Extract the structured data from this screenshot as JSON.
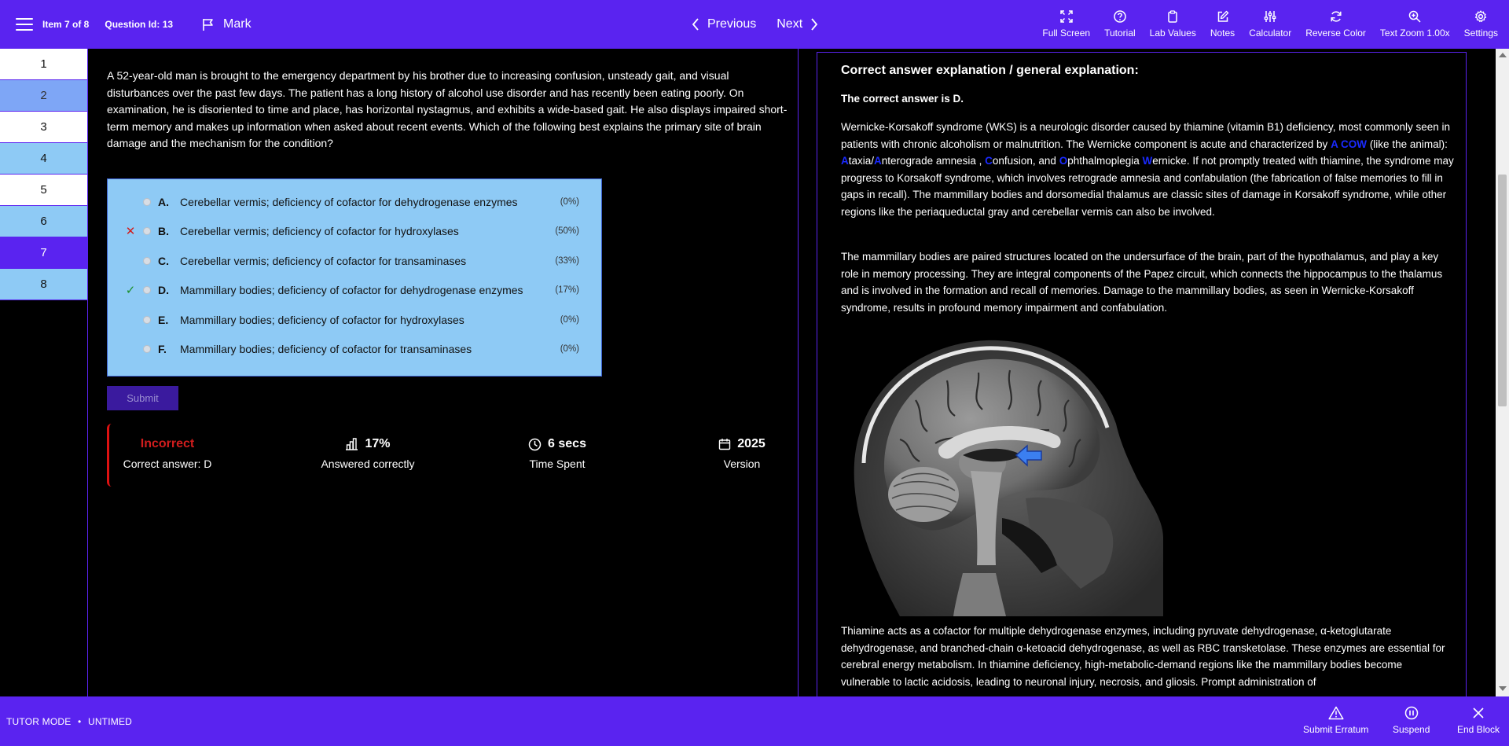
{
  "topbar": {
    "item_label": "Item 7 of 8",
    "question_id": "Question Id: 13",
    "mark_label": "Mark",
    "previous_label": "Previous",
    "next_label": "Next",
    "tools": [
      {
        "label": "Full Screen",
        "icon": "fullscreen-icon"
      },
      {
        "label": "Tutorial",
        "icon": "help-icon"
      },
      {
        "label": "Lab Values",
        "icon": "clipboard-icon"
      },
      {
        "label": "Notes",
        "icon": "edit-icon"
      },
      {
        "label": "Calculator",
        "icon": "sliders-icon"
      },
      {
        "label": "Reverse Color",
        "icon": "refresh-icon"
      },
      {
        "label": "Text Zoom 1.00x",
        "icon": "zoom-icon"
      },
      {
        "label": "Settings",
        "icon": "gear-icon"
      }
    ]
  },
  "sidebar": {
    "items": [
      {
        "label": "1",
        "state": "unanswered"
      },
      {
        "label": "2",
        "state": "visited"
      },
      {
        "label": "3",
        "state": "unanswered"
      },
      {
        "label": "4",
        "state": "answered"
      },
      {
        "label": "5",
        "state": "unanswered"
      },
      {
        "label": "6",
        "state": "answered"
      },
      {
        "label": "7",
        "state": "current"
      },
      {
        "label": "8",
        "state": "answered"
      }
    ]
  },
  "question": {
    "stem": "A 52-year-old man is brought to the emergency department by his brother due to increasing confusion, unsteady gait, and visual disturbances over the past few days. The patient has a long history of alcohol use disorder and has recently been eating poorly. On examination, he is disoriented to time and place, has horizontal nystagmus, and exhibits a wide-based gait. He also displays impaired short-term memory and makes up information when asked about recent events. Which of the following best explains the primary site of brain damage and the mechanism for the condition?",
    "choices": [
      {
        "letter": "A.",
        "text": "Cerebellar vermis; deficiency of cofactor for dehydrogenase enzymes",
        "pct": "(0%)",
        "status": ""
      },
      {
        "letter": "B.",
        "text": "Cerebellar vermis; deficiency of cofactor for hydroxylases",
        "pct": "(50%)",
        "status": "wrong"
      },
      {
        "letter": "C.",
        "text": "Cerebellar vermis; deficiency of cofactor for transaminases",
        "pct": "(33%)",
        "status": ""
      },
      {
        "letter": "D.",
        "text": "Mammillary bodies; deficiency of cofactor for dehydrogenase enzymes",
        "pct": "(17%)",
        "status": "right"
      },
      {
        "letter": "E.",
        "text": "Mammillary bodies; deficiency of cofactor for hydroxylases",
        "pct": "(0%)",
        "status": ""
      },
      {
        "letter": "F.",
        "text": "Mammillary bodies; deficiency of cofactor for transaminases",
        "pct": "(0%)",
        "status": ""
      }
    ],
    "submit_label": "Submit"
  },
  "result": {
    "status": "Incorrect",
    "correct_answer": "Correct answer: D",
    "pct": "17%",
    "pct_label": "Answered correctly",
    "time": "6 secs",
    "time_label": "Time Spent",
    "version": "2025",
    "version_label": "Version"
  },
  "explanation": {
    "title": "Correct answer explanation / general explanation:",
    "correct": "The correct answer is D.",
    "p1_a": "Wernicke-Korsakoff syndrome (WKS) is a neurologic disorder caused by thiamine (vitamin B1) deficiency, most commonly seen in patients with chronic alcoholism or malnutrition. The Wernicke component is acute and characterized by ",
    "p1_acro": "A COW",
    "p1_b": " (like the animal): ",
    "p1_a1": "A",
    "p1_t1": "taxia/",
    "p1_a2": "A",
    "p1_t2": "nterograde amnesia , ",
    "p1_a3": "C",
    "p1_t3": "onfusion, and ",
    "p1_a4": "O",
    "p1_t4": "phthalmoplegia ",
    "p1_a5": "W",
    "p1_c": "ernicke. If not promptly treated with thiamine, the syndrome may progress to Korsakoff syndrome, which involves retrograde amnesia and confabulation (the fabrication of false memories to fill in gaps in recall). The mammillary bodies and dorsomedial thalamus are classic sites of damage in Korsakoff syndrome, while other regions like the periaqueductal gray and cerebellar vermis can also be involved.",
    "p2": "The mammillary bodies are paired structures located on the undersurface of the brain, part of the hypothalamus, and play a key role in memory processing. They are integral components of the Papez circuit, which connects the hippocampus to the thalamus and is involved in the formation and recall of memories. Damage to the mammillary bodies, as seen in Wernicke-Korsakoff syndrome, results in profound memory impairment and confabulation.",
    "p3": "Thiamine acts as a cofactor for multiple dehydrogenase enzymes, including pyruvate dehydrogenase, α-ketoglutarate dehydrogenase, and branched-chain α-ketoacid dehydrogenase, as well as RBC transketolase. These enzymes are essential for cerebral energy metabolism. In thiamine deficiency, high-metabolic-demand regions like the mammillary bodies become vulnerable to lactic acidosis, leading to neuronal injury, necrosis, and gliosis. Prompt administration of"
  },
  "bottombar": {
    "mode": "TUTOR MODE",
    "separator": "•",
    "timing": "UNTIMED",
    "submit_erratum": "Submit Erratum",
    "suspend": "Suspend",
    "end_block": "End Block"
  },
  "colors": {
    "bar": "#5a23f0",
    "choices_bg": "#8ecaf5",
    "incorrect": "#d11d1d",
    "acronym": "#1a2aff"
  }
}
